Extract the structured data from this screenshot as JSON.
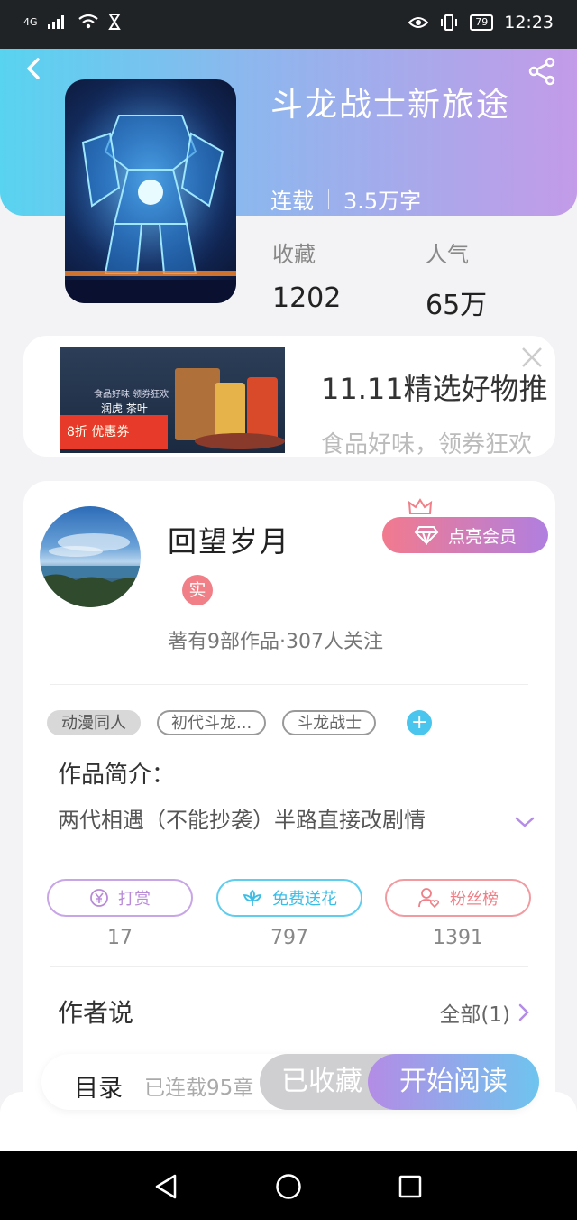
{
  "status_bar": {
    "network": "4G",
    "battery": "79",
    "time": "12:23"
  },
  "book": {
    "title": "斗龙战士新旅途",
    "status": "连载",
    "word_count": "3.5万字",
    "stats": [
      {
        "label": "收藏",
        "value": "1202"
      },
      {
        "label": "人气",
        "value": "65万"
      }
    ]
  },
  "ad": {
    "title": "11.11精选好物推",
    "subtitle": "食品好味，领券狂欢",
    "image_caption": "食品好味 领券狂欢",
    "image_brand": "润虎 茶叶",
    "image_coupon": "8折 优惠券"
  },
  "author": {
    "name": "回望岁月",
    "badge": "实",
    "stats_text": "著有9部作品·307人关注",
    "vip_button": "点亮会员"
  },
  "tags": [
    "动漫同人",
    "初代斗龙...",
    "斗龙战士"
  ],
  "intro": {
    "label": "作品简介：",
    "text": "两代相遇（不能抄袭）半路直接改剧情"
  },
  "actions": [
    {
      "label": "打赏",
      "count": "17",
      "color": "#b88ad8"
    },
    {
      "label": "免费送花",
      "count": "797",
      "color": "#4ac6ee"
    },
    {
      "label": "粉丝榜",
      "count": "1391",
      "color": "#ef7f87"
    }
  ],
  "author_says": {
    "title": "作者说",
    "all_link": "全部(1)"
  },
  "bottom_bar": {
    "catalog": "目录",
    "serial_count": "已连载95章",
    "collected": "已收藏",
    "read": "开始阅读"
  },
  "colors": {
    "header_gradient_start": "#58d3f0",
    "header_gradient_end": "#c39be8",
    "accent_purple": "#b48ce6",
    "accent_cyan": "#4ac6ee",
    "accent_pink": "#ef7f87"
  }
}
